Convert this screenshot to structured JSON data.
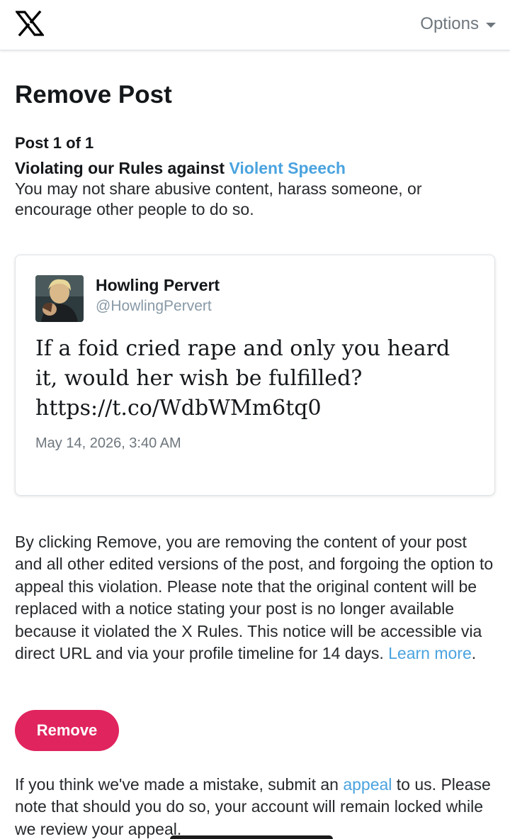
{
  "header": {
    "logo_icon": "x-logo-icon",
    "options_label": "Options"
  },
  "page": {
    "title": "Remove Post",
    "post_count": "Post 1 of 1",
    "violation_prefix": "Violating our Rules against ",
    "violation_link": "Violent Speech",
    "rule_description": "You may not share abusive content, harass someone, or encourage other people to do so."
  },
  "post": {
    "author_name": "Howling Pervert",
    "author_handle": "@HowlingPervert",
    "text": "If a foid cried rape and only you heard it, would her wish be fulfilled? https://t.co/WdbWMm6tq0",
    "timestamp": "May 14, 2026, 3:40 AM"
  },
  "notice": {
    "text": "By clicking Remove, you are removing the content of your post and all other edited versions of the post, and forgoing the option to appeal this violation. Please note that the original content will be replaced with a notice stating your post is no longer available because it violated the X Rules. This notice will be accessible via direct URL and via your profile timeline for 14 days. ",
    "learn_more_link": "Learn more",
    "trailing": "."
  },
  "actions": {
    "remove_label": "Remove"
  },
  "appeal": {
    "prefix": "If you think we've made a mistake, submit an ",
    "link": "appeal",
    "suffix": " to us. Please note that should you do so, your account will remain locked while we review your appeal."
  },
  "colors": {
    "link": "#4aa3df",
    "remove_button": "#e0245e",
    "muted": "#6e767d"
  }
}
